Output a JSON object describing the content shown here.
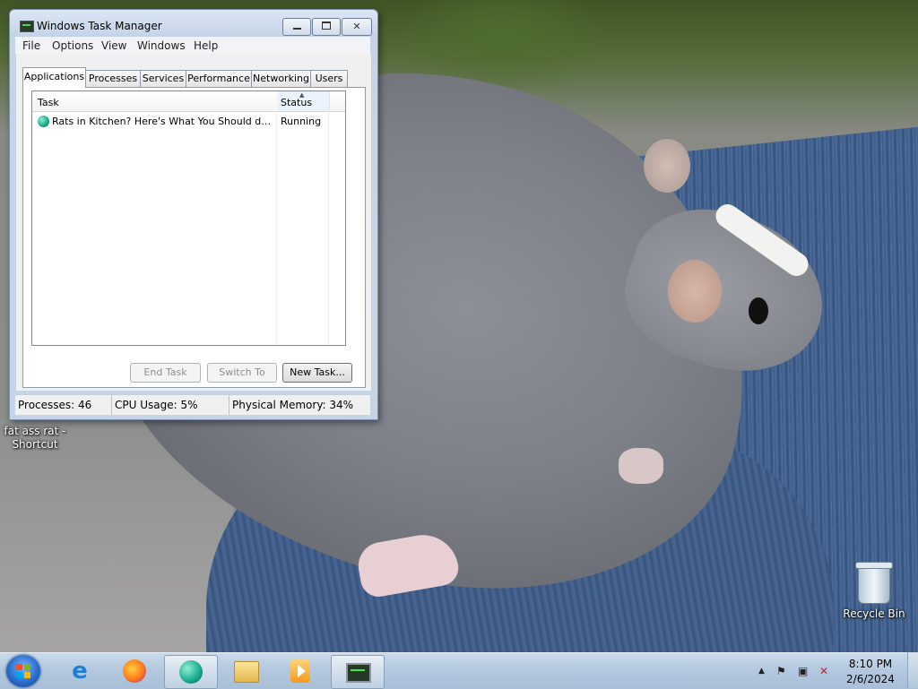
{
  "window": {
    "title": "Windows Task Manager",
    "menu": [
      "File",
      "Options",
      "View",
      "Windows",
      "Help"
    ],
    "tabs": [
      "Applications",
      "Processes",
      "Services",
      "Performance",
      "Networking",
      "Users"
    ],
    "active_tab": "Applications",
    "columns": {
      "task": "Task",
      "status": "Status"
    },
    "rows": [
      {
        "task": "Rats in Kitchen? Here's What You Should do | Ex...",
        "status": "Running",
        "icon": "app-icon"
      }
    ],
    "buttons": {
      "end_task": "End Task",
      "switch_to": "Switch To",
      "new_task": "New Task..."
    },
    "status_bar": {
      "processes": "Processes: 46",
      "cpu": "CPU Usage: 5%",
      "memory": "Physical Memory: 34%"
    }
  },
  "desktop": {
    "shortcut_label": "fat ass rat - Shortcut",
    "recycle_bin_label": "Recycle Bin"
  },
  "taskbar": {
    "pinned": [
      "internet-explorer-icon",
      "firefox-icon",
      "app-icon",
      "windows-explorer-icon",
      "media-player-icon",
      "task-manager-icon"
    ],
    "clock": {
      "time": "8:10 PM",
      "date": "2/6/2024"
    }
  },
  "colors": {
    "taskbar": "#b4c9df",
    "window_frame": "#c5d4e6",
    "app_icon": "#17a88a"
  }
}
